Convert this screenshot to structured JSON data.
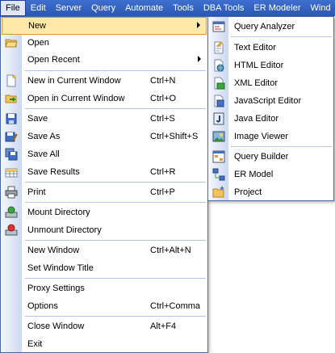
{
  "menubar": {
    "items": [
      "File",
      "Edit",
      "Server",
      "Query",
      "Automate",
      "Tools",
      "DBA Tools",
      "ER Modeler",
      "Wind"
    ]
  },
  "file_menu": {
    "items": [
      {
        "label": "New",
        "shortcut": "",
        "submenu": true,
        "icon": "",
        "highlighted": true
      },
      {
        "label": "Open",
        "shortcut": "",
        "icon": "folder-open-icon"
      },
      {
        "label": "Open Recent",
        "shortcut": "",
        "submenu": true,
        "icon": ""
      },
      {
        "label": "New in Current Window",
        "shortcut": "Ctrl+N",
        "icon": "new-document-icon"
      },
      {
        "label": "Open in Current Window",
        "shortcut": "Ctrl+O",
        "icon": "open-folder-arrow-icon"
      },
      {
        "label": "Save",
        "shortcut": "Ctrl+S",
        "icon": "floppy-disk-icon"
      },
      {
        "label": "Save As",
        "shortcut": "Ctrl+Shift+S",
        "icon": "save-as-icon"
      },
      {
        "label": "Save All",
        "shortcut": "",
        "icon": "save-all-icon"
      },
      {
        "label": "Save Results",
        "shortcut": "Ctrl+R",
        "icon": "save-results-icon"
      },
      {
        "label": "Print",
        "shortcut": "Ctrl+P",
        "icon": "printer-icon"
      },
      {
        "label": "Mount Directory",
        "shortcut": "",
        "icon": "mount-drive-icon"
      },
      {
        "label": "Unmount Directory",
        "shortcut": "",
        "icon": "unmount-drive-icon"
      },
      {
        "label": "New Window",
        "shortcut": "Ctrl+Alt+N",
        "icon": ""
      },
      {
        "label": "Set Window Title",
        "shortcut": "",
        "icon": ""
      },
      {
        "label": "Proxy Settings",
        "shortcut": "",
        "icon": ""
      },
      {
        "label": "Options",
        "shortcut": "Ctrl+Comma",
        "icon": ""
      },
      {
        "label": "Close Window",
        "shortcut": "Alt+F4",
        "icon": ""
      },
      {
        "label": "Exit",
        "shortcut": "",
        "icon": ""
      }
    ]
  },
  "new_submenu": {
    "items": [
      {
        "label": "Query Analyzer",
        "icon": "query-analyzer-icon"
      },
      {
        "label": "Text Editor",
        "icon": "text-editor-icon"
      },
      {
        "label": "HTML Editor",
        "icon": "html-editor-icon"
      },
      {
        "label": "XML Editor",
        "icon": "xml-editor-icon"
      },
      {
        "label": "JavaScript Editor",
        "icon": "javascript-editor-icon"
      },
      {
        "label": "Java Editor",
        "icon": "java-editor-icon"
      },
      {
        "label": "Image Viewer",
        "icon": "image-viewer-icon"
      },
      {
        "label": "Query Builder",
        "icon": "query-builder-icon"
      },
      {
        "label": "ER Model",
        "icon": "er-model-icon"
      },
      {
        "label": "Project",
        "icon": "project-icon"
      }
    ]
  },
  "colors": {
    "menubar": "#2f5fc4",
    "highlight": "#ffe9a8",
    "highlight_border": "#d79b35",
    "gutter": "#cdd9ef",
    "separator": "#b6c3e0"
  }
}
